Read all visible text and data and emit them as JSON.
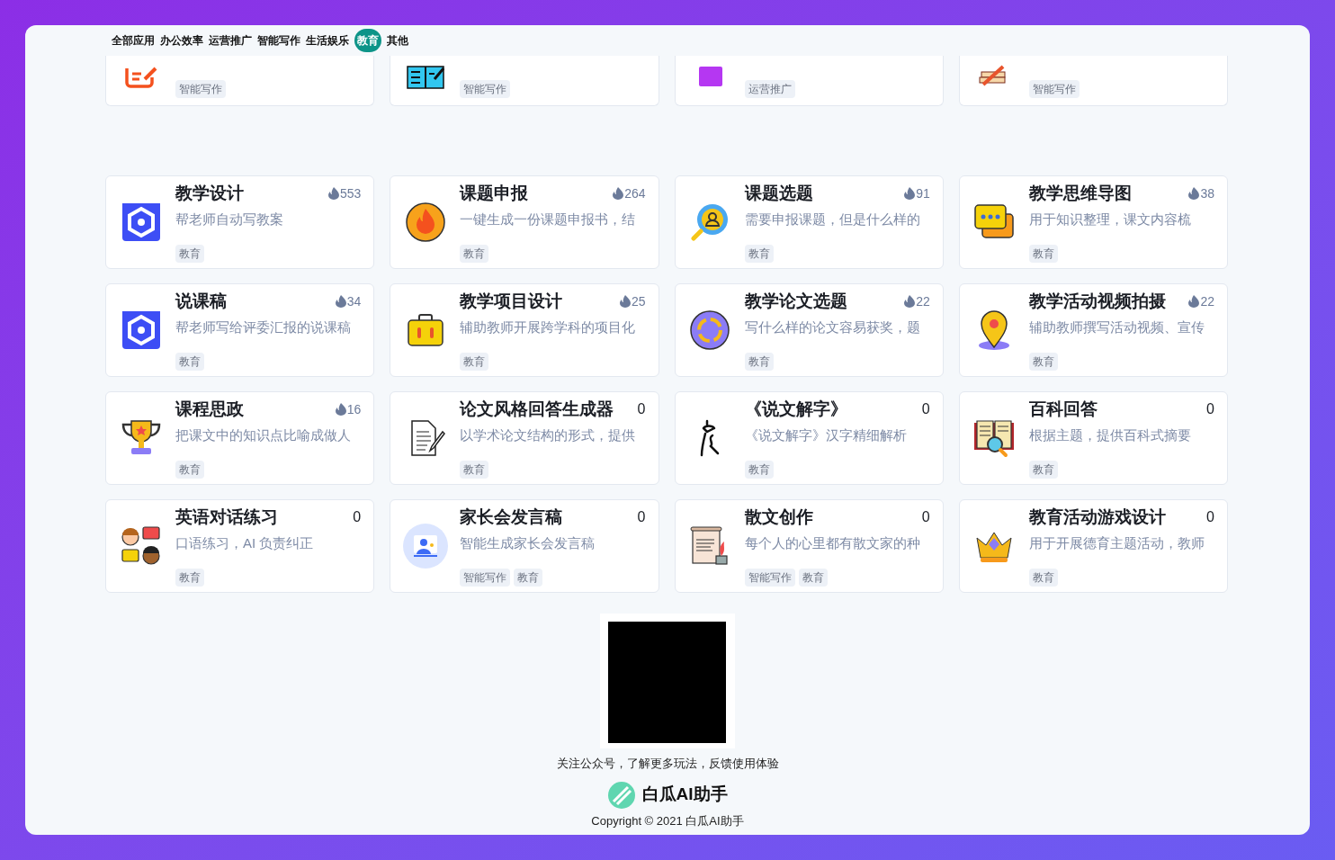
{
  "tabs": [
    {
      "label": "全部应用",
      "selected": false
    },
    {
      "label": "办公效率",
      "selected": false
    },
    {
      "label": "运营推广",
      "selected": false
    },
    {
      "label": "智能写作",
      "selected": false
    },
    {
      "label": "生活娱乐",
      "selected": false
    },
    {
      "label": "教育",
      "selected": true
    },
    {
      "label": "其他",
      "selected": false
    }
  ],
  "partial_cards": [
    {
      "tags": [
        "智能写作"
      ]
    },
    {
      "tags": [
        "智能写作"
      ]
    },
    {
      "tags": [
        "运营推广"
      ]
    },
    {
      "tags": [
        "智能写作"
      ]
    }
  ],
  "cards": [
    {
      "title": "教学设计",
      "description": "帮老师自动写教案",
      "count": "553",
      "hot": true,
      "tags": [
        "教育"
      ]
    },
    {
      "title": "课题申报",
      "description": "一键生成一份课题申报书，结",
      "count": "264",
      "hot": true,
      "tags": [
        "教育"
      ]
    },
    {
      "title": "课题选题",
      "description": "需要申报课题，但是什么样的",
      "count": "91",
      "hot": true,
      "tags": [
        "教育"
      ]
    },
    {
      "title": "教学思维导图",
      "description": "用于知识整理，课文内容梳",
      "count": "38",
      "hot": true,
      "tags": [
        "教育"
      ]
    },
    {
      "title": "说课稿",
      "description": "帮老师写给评委汇报的说课稿",
      "count": "34",
      "hot": true,
      "tags": [
        "教育"
      ]
    },
    {
      "title": "教学项目设计",
      "description": "辅助教师开展跨学科的项目化",
      "count": "25",
      "hot": true,
      "tags": [
        "教育"
      ]
    },
    {
      "title": "教学论文选题",
      "description": "写什么样的论文容易获奖，题",
      "count": "22",
      "hot": true,
      "tags": [
        "教育"
      ]
    },
    {
      "title": "教学活动视频拍摄",
      "description": "辅助教师撰写活动视频、宣传",
      "count": "22",
      "hot": true,
      "tags": [
        "教育"
      ]
    },
    {
      "title": "课程思政",
      "description": "把课文中的知识点比喻成做人",
      "count": "16",
      "hot": true,
      "tags": [
        "教育"
      ]
    },
    {
      "title": "论文风格回答生成器",
      "description": "以学术论文结构的形式，提供",
      "count": "0",
      "hot": false,
      "tags": [
        "教育"
      ]
    },
    {
      "title": "《说文解字》",
      "description": "《说文解字》汉字精细解析",
      "count": "0",
      "hot": false,
      "tags": [
        "教育"
      ]
    },
    {
      "title": "百科回答",
      "description": "根据主题，提供百科式摘要",
      "count": "0",
      "hot": false,
      "tags": [
        "教育"
      ]
    },
    {
      "title": "英语对话练习",
      "description": "口语练习，AI 负责纠正",
      "count": "0",
      "hot": false,
      "tags": [
        "教育"
      ]
    },
    {
      "title": "家长会发言稿",
      "description": "智能生成家长会发言稿",
      "count": "0",
      "hot": false,
      "tags": [
        "智能写作",
        "教育"
      ]
    },
    {
      "title": "散文创作",
      "description": "每个人的心里都有散文家的种",
      "count": "0",
      "hot": false,
      "tags": [
        "智能写作",
        "教育"
      ]
    },
    {
      "title": "教育活动游戏设计",
      "description": "用于开展德育主题活动，教师",
      "count": "0",
      "hot": false,
      "tags": [
        "教育"
      ]
    }
  ],
  "footer": {
    "caption": "关注公众号，了解更多玩法，反馈使用体验",
    "brand": "白瓜AI助手",
    "copyright": "Copyright © 2021 白瓜AI助手"
  }
}
